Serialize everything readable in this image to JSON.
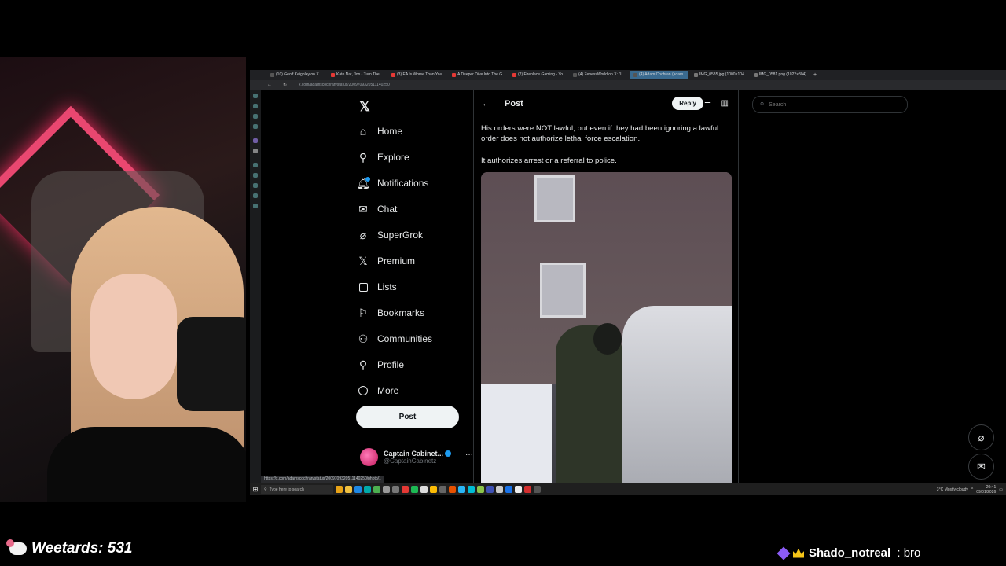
{
  "browser": {
    "tabs": [
      {
        "label": "(10) Geoff Keighley on X"
      },
      {
        "label": "Kato Nat, Jon - Turn The"
      },
      {
        "label": "(3) EA Is Worse Than You"
      },
      {
        "label": "A Deeper Dive Into The G"
      },
      {
        "label": "(2) Fireplace Gaming - Yo"
      },
      {
        "label": "(4) ZenessWorld on X: \"I"
      },
      {
        "label": "(4) Adam Cochran (adam"
      },
      {
        "label": "IMG_0585.jpg (1000×104"
      },
      {
        "label": "IMG_0581.png (1022×804)"
      }
    ],
    "active_tab_index": 6,
    "url": "x.com/adamscochran/status/2009709320511140250",
    "status_url": "https://x.com/adamscochran/status/2009709320511140250/photo/1"
  },
  "x": {
    "nav": [
      {
        "label": "Home",
        "icon": "home-icon"
      },
      {
        "label": "Explore",
        "icon": "search-icon"
      },
      {
        "label": "Notifications",
        "icon": "bell-icon"
      },
      {
        "label": "Chat",
        "icon": "mail-icon"
      },
      {
        "label": "SuperGrok",
        "icon": "grok-icon"
      },
      {
        "label": "Premium",
        "icon": "x-icon"
      },
      {
        "label": "Lists",
        "icon": "list-icon"
      },
      {
        "label": "Bookmarks",
        "icon": "bookmark-icon"
      },
      {
        "label": "Communities",
        "icon": "people-icon"
      },
      {
        "label": "Profile",
        "icon": "person-icon"
      },
      {
        "label": "More",
        "icon": "more-circle-icon"
      }
    ],
    "post_button": "Post",
    "account": {
      "name": "Captain Cabinet...",
      "handle": "@CaptainCabinetz"
    },
    "header": {
      "title": "Post",
      "reply_button": "Reply"
    },
    "post": {
      "paragraph1": "His orders were NOT lawful, but even if they had been ignoring a lawful order does not authorize lethal force escalation.",
      "paragraph2": "It authorizes arrest or a referral to police."
    },
    "search": {
      "placeholder": "Search"
    }
  },
  "taskbar": {
    "search_placeholder": "Type here to search",
    "weather": "3°C  Mostly cloudy",
    "time": "20:41",
    "date": "09/01/2026"
  },
  "overlay": {
    "counter_label": "Weetards: 531",
    "chat_user": "Shado_notreal",
    "chat_sep": " : ",
    "chat_message": "bro"
  },
  "colors": {
    "accent": "#1d9bf0",
    "background": "#000000",
    "text": "#e7e9ea"
  }
}
